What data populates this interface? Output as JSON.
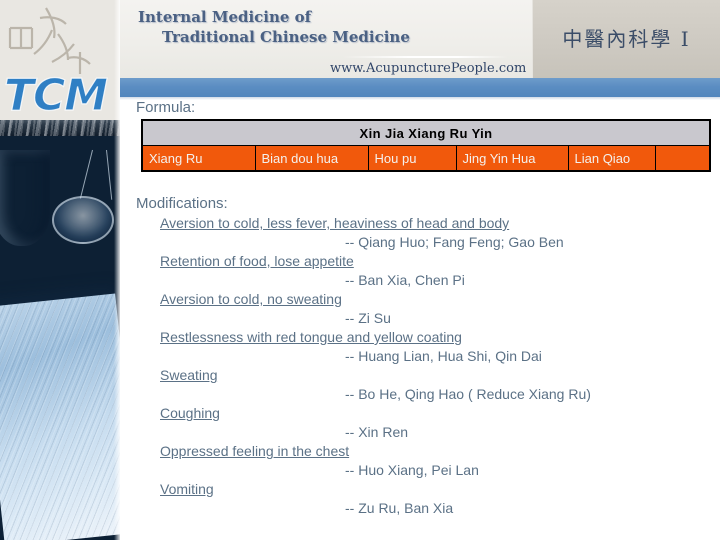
{
  "header": {
    "title_line1": "Internal Medicine of",
    "title_line2": "Traditional Chinese Medicine",
    "website": "www.AcupuncturePeople.com",
    "chinese_title": "中醫內科學 I",
    "logo_text": "TCM",
    "accent_blue": "#5b8dc2",
    "panel_gray": "#cdc9c1"
  },
  "body": {
    "formula_label": "Formula:",
    "modifications_label": "Modifications:"
  },
  "formula_table": {
    "title": "Xin Jia Xiang Ru Yin",
    "header_bg": "#c9c8ce",
    "cell_bg": "#f1590c",
    "ingredients": [
      {
        "name": "Xiang Ru",
        "width": 113
      },
      {
        "name": "Bian dou hua",
        "width": 113
      },
      {
        "name": "Hou pu",
        "width": 88
      },
      {
        "name": "Jing Yin Hua",
        "width": 112
      },
      {
        "name": "Lian Qiao",
        "width": 87
      },
      {
        "name": "",
        "width": 55
      }
    ]
  },
  "modifications": [
    {
      "symptom": "Aversion to cold, less fever, heaviness of head and body",
      "herbs": "-- Qiang Huo; Fang Feng; Gao Ben"
    },
    {
      "symptom": "Retention of food, lose appetite",
      "herbs": "-- Ban Xia, Chen Pi"
    },
    {
      "symptom": "Aversion to cold, no sweating",
      "herbs": "-- Zi Su"
    },
    {
      "symptom": "Restlessness with red tongue and yellow coating",
      "herbs": "-- Huang Lian, Hua Shi, Qin Dai"
    },
    {
      "symptom": "Sweating",
      "herbs": "-- Bo He, Qing Hao  ( Reduce Xiang Ru)"
    },
    {
      "symptom": "Coughing",
      "herbs": "-- Xin Ren"
    },
    {
      "symptom": "Oppressed feeling in the chest",
      "herbs": "-- Huo Xiang, Pei Lan"
    },
    {
      "symptom": "Vomiting",
      "herbs": "-- Zu Ru, Ban Xia"
    }
  ]
}
